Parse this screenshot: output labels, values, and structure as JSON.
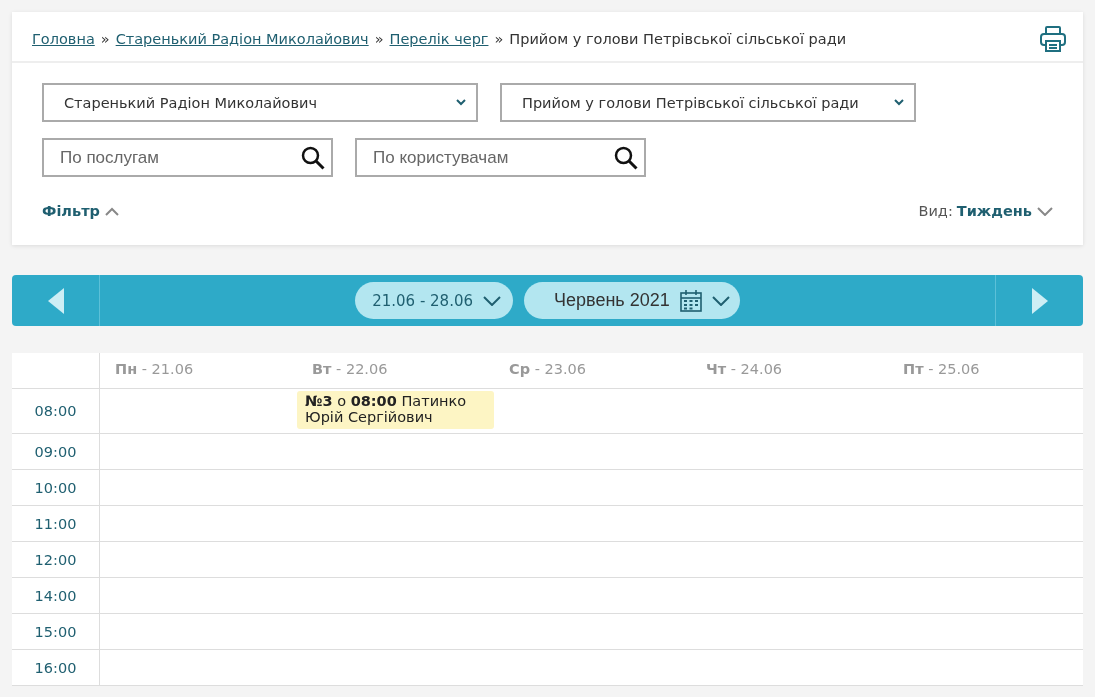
{
  "breadcrumbs": [
    {
      "label": "Головна",
      "link": true
    },
    {
      "label": "Старенький Радіон Миколайович",
      "link": true
    },
    {
      "label": "Перелік черг",
      "link": true
    },
    {
      "label": "Прийом у голови Петрівської сільської ради",
      "link": false
    }
  ],
  "separator": "»",
  "selects": [
    {
      "value": "Старенький Радіон Миколайович"
    },
    {
      "value": "Прийом у голови Петрівської сільської ради"
    }
  ],
  "searches": [
    {
      "placeholder": "По послугам"
    },
    {
      "placeholder": "По користувачам"
    }
  ],
  "filter": {
    "label": "Фільтр",
    "expanded": true
  },
  "view": {
    "label": "Вид:",
    "value": "Тиждень"
  },
  "nav": {
    "week": "21.06 - 28.06",
    "month": "Червень 2021"
  },
  "days": [
    {
      "short": "Пн",
      "date": "- 21.06"
    },
    {
      "short": "Вт",
      "date": "- 22.06",
      "events": [
        {
          "text": "**№3** о **08:00** Патинко Юрій Сергійович"
        }
      ]
    },
    {
      "short": "Ср",
      "date": "- 23.06"
    },
    {
      "short": "Чт",
      "date": "- 24.06"
    },
    {
      "short": "Пт",
      "date": "- 25.06"
    }
  ],
  "times": [
    "08:00",
    "09:00",
    "10:00",
    "11:00",
    "12:00",
    "14:00",
    "15:00",
    "16:00"
  ]
}
